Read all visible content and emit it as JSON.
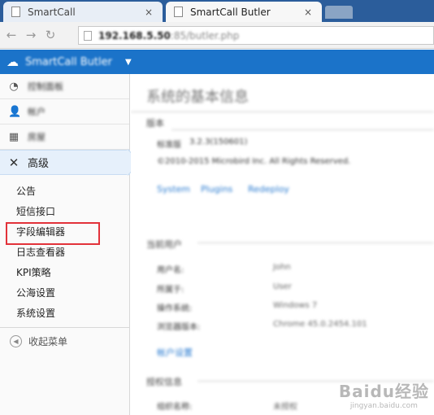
{
  "browser": {
    "tabs": [
      {
        "title": "SmartCall",
        "close": "×"
      },
      {
        "title": "SmartCall Butler",
        "close": "×"
      }
    ],
    "url": {
      "host": "192.168.5.50",
      "path": ":85/butler.php"
    },
    "nav": {
      "back": "←",
      "forward": "→",
      "reload": "↻"
    }
  },
  "app": {
    "title": "SmartCall Butler",
    "caret": "▼",
    "icons": {
      "logo": "cloud-icon"
    }
  },
  "sidebar": {
    "items": [
      {
        "label": "控制面板",
        "icon": "◔"
      },
      {
        "label": "帐户",
        "icon": "👤"
      },
      {
        "label": "房屋",
        "icon": "▦"
      },
      {
        "label": "高级",
        "icon": "✕"
      }
    ],
    "submenu": [
      "公告",
      "短信接口",
      "字段编辑器",
      "日志查看器",
      "KPI策略",
      "公海设置",
      "系统设置"
    ],
    "collapse_label": "收起菜单",
    "collapse_icon": "◀"
  },
  "main": {
    "heading": "系统的基本信息",
    "version_section": "版本",
    "version_label": "标准版",
    "version_value": "3.2.3(150601)",
    "copyright": "©2010-2015 Microbird Inc. All Rights Reserved.",
    "links": [
      "System",
      "Plugins",
      "Redeploy"
    ],
    "user_section": "当前用户",
    "user_rows": [
      {
        "k": "用户名:",
        "v": "John"
      },
      {
        "k": "所属于:",
        "v": "User"
      },
      {
        "k": "操作系统:",
        "v": "Windows 7"
      },
      {
        "k": "浏览器版本:",
        "v": "Chrome 45.0.2454.101"
      }
    ],
    "account_link": "帐户设置",
    "license_section": "授权信息",
    "license_rows": [
      {
        "k": "组织名称:",
        "v": "未授权"
      }
    ]
  },
  "watermark": {
    "line1": "Baidu经验",
    "line2": "jingyan.baidu.com"
  }
}
